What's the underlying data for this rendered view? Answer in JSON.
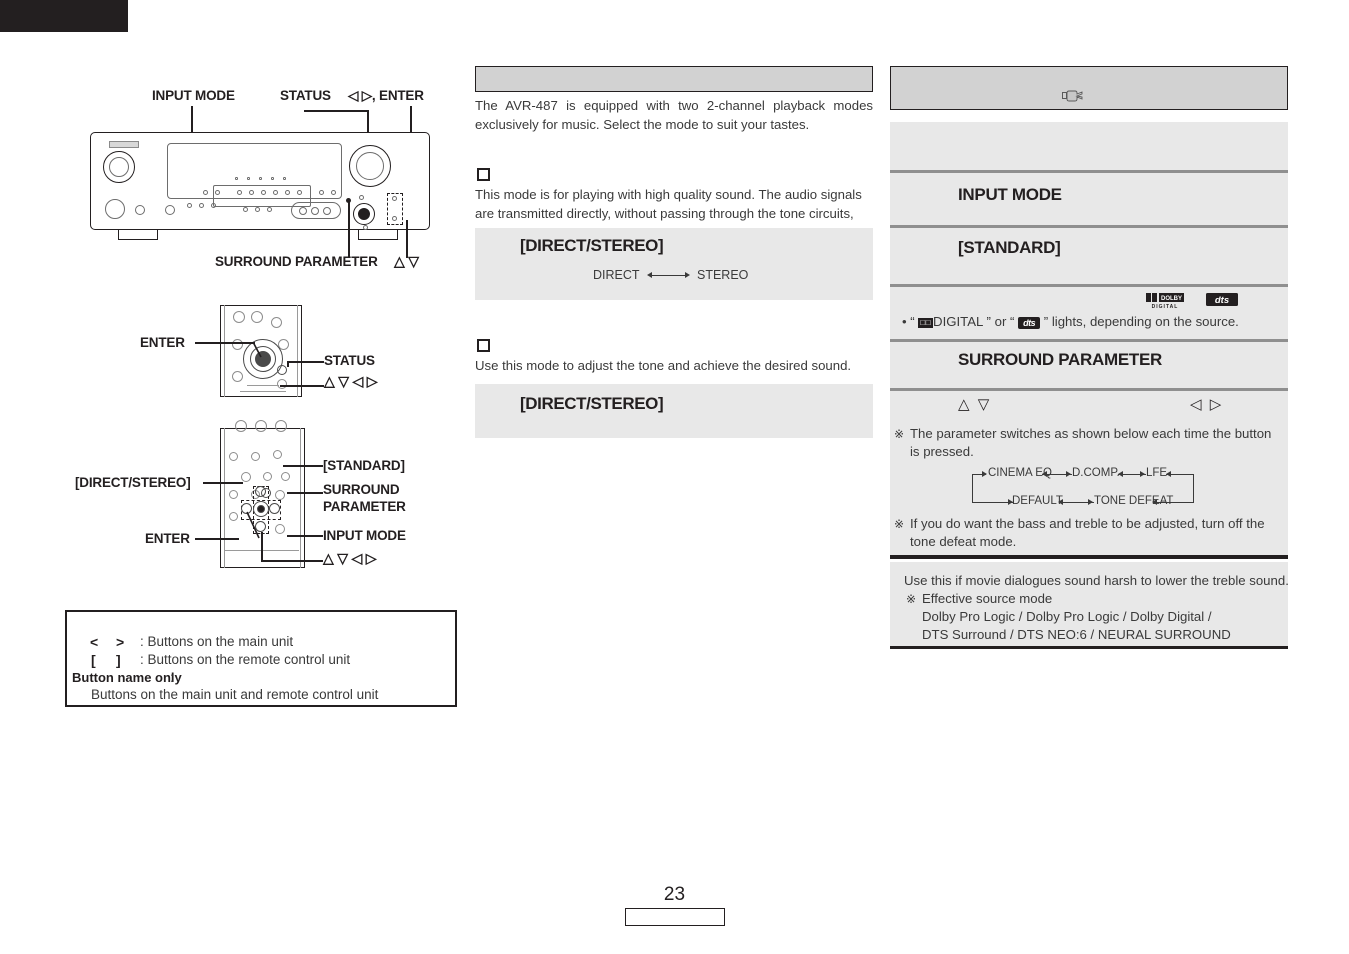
{
  "document": {
    "page_number": "23",
    "product": "AVR-487"
  },
  "left_column": {
    "main_unit_figure": {
      "labels": {
        "input_mode": "INPUT MODE",
        "status": "STATUS",
        "cursor_enter": "◁ ▷, ENTER",
        "surround_parameter": "SURROUND PARAMETER",
        "up_down": "△ ▽"
      }
    },
    "remote_figure_top": {
      "labels": {
        "enter": "ENTER",
        "status": "STATUS",
        "cursor": "△ ▽ ◁ ▷"
      }
    },
    "remote_figure_bottom": {
      "labels": {
        "direct_stereo": "[DIRECT/STEREO]",
        "standard": "[STANDARD]",
        "surround_parameter_1": "SURROUND",
        "surround_parameter_2": "PARAMETER",
        "enter": "ENTER",
        "input_mode": "INPUT MODE",
        "cursor": "△ ▽ ◁ ▷"
      }
    },
    "legend": {
      "row1_symbol_open": "<",
      "row1_symbol_close": ">",
      "row1_text": ": Buttons on the main unit",
      "row2_symbol_open": "[",
      "row2_symbol_close": "]",
      "row2_text": ": Buttons on the remote control unit",
      "row3_bold": "Button name only",
      "row3_colon": ":",
      "row4_text": "Buttons on the main unit and remote control unit"
    }
  },
  "center_column": {
    "header_title": "",
    "intro": "The AVR-487 is equipped with two 2-channel playback modes exclusively for music. Select the mode to suit your tastes.",
    "section1": {
      "heading": "",
      "description": "This mode is for playing with high quality sound. The audio signals are transmitted directly, without passing through the tone circuits, etc.",
      "box_title": "[DIRECT/STEREO]",
      "flow_left": "DIRECT",
      "flow_right": "STEREO"
    },
    "section2": {
      "heading": "",
      "description": "Use this mode to adjust the tone and achieve the desired sound.",
      "box_title": "[DIRECT/STEREO]"
    }
  },
  "right_column": {
    "header_title": "",
    "hand_icon": "hand-pointing-icon",
    "sections": [
      {
        "title": "INPUT MODE"
      },
      {
        "title": "[STANDARD]"
      },
      {
        "title": "SURROUND PARAMETER"
      }
    ],
    "logo_note": {
      "bullet": "•",
      "quote_open": "”",
      "prefix": "“",
      "dolby_text": "DIGITAL",
      "dolby_mark": "□□",
      "or_text": "or",
      "dts_text": "dts",
      "suffix": "lights, depending on the source.",
      "logo_dolby_top": "DOLBY",
      "logo_dolby_bottom": "D I G I T A L",
      "logo_dts": "dts"
    },
    "param_arrows": {
      "up_down": "△ ▽",
      "left_right": "◁ ▷"
    },
    "note1": {
      "symbol": "※",
      "text": "The parameter switches as shown below each time the button is pressed."
    },
    "flow_diagram": {
      "top_row": [
        "CINEMA EQ",
        "D.COMP.",
        "LFE"
      ],
      "bottom_row": [
        "DEFAULT",
        "TONE DEFEAT"
      ]
    },
    "note2": {
      "symbol": "※",
      "text": "If you do want the bass and treble to be adjusted, turn off the tone defeat mode."
    },
    "footer_note": {
      "line1": "Use this if movie dialogues sound harsh to lower the treble sound.",
      "symbol": "※",
      "line2": "Effective source mode",
      "line3": "Dolby Pro Logic     / Dolby Pro Logic / Dolby Digital /",
      "line4": "DTS Surround / DTS NEO:6 / NEURAL SURROUND"
    }
  },
  "colors": {
    "ink": "#231f20",
    "header_gray": "#d2d2d2",
    "panel_gray": "#e8e8e8",
    "rule_gray": "#8f8f8f"
  }
}
